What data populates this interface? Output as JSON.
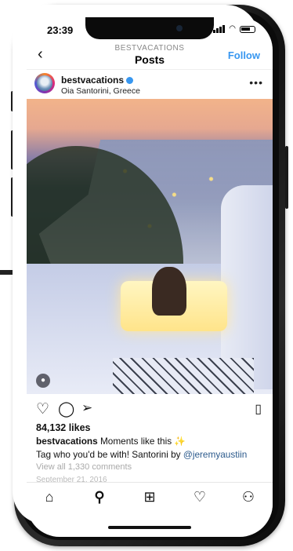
{
  "status": {
    "time": "23:39"
  },
  "nav": {
    "subtitle": "BESTVACATIONS",
    "title": "Posts",
    "follow_label": "Follow"
  },
  "post": {
    "username": "bestvacations",
    "location": "Oia Santorini, Greece",
    "likes": "84,132 likes",
    "caption_user": "bestvacations",
    "caption_text": " Moments like this ",
    "caption_line2": "Tag who you'd be with! Santorini by ",
    "caption_mention": "@jeremyaustiin",
    "view_comments": "View all 1,330 comments",
    "date": "September 21, 2016"
  },
  "icons": {
    "back": "chevron-left-icon",
    "more": "more-dots-icon",
    "like": "heart-icon",
    "comment": "comment-icon",
    "share": "send-icon",
    "save": "bookmark-icon",
    "tag": "user-tag-icon",
    "tabs": [
      "home-icon",
      "search-icon",
      "add-post-icon",
      "activity-icon",
      "profile-icon"
    ]
  },
  "colors": {
    "link_blue": "#3897f0",
    "mention": "#2c5a8c"
  }
}
